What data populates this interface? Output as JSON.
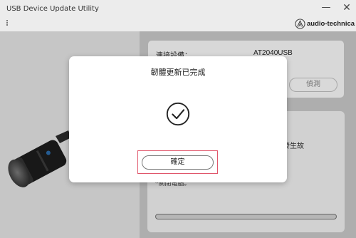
{
  "window": {
    "title": "USB Device Update Utility",
    "minimize_glyph": "—",
    "close_glyph": "✕",
    "menu_icon": "kebab-menu-icon"
  },
  "brand": {
    "logo_icon": "audio-technica-logo-icon",
    "name": "audio-technica"
  },
  "device_info": {
    "label": "連接設備：",
    "value": "AT2040USB",
    "detect_button": "偵測"
  },
  "update_panel": {
    "note_fragment": "品可能發生故",
    "note_fragment2": "*關閉電腦。",
    "progress": 1.0
  },
  "dialog": {
    "message": "韌體更新已完成",
    "icon": "check-circle-icon",
    "ok_button": "確定",
    "highlight_color": "#e0566b"
  }
}
